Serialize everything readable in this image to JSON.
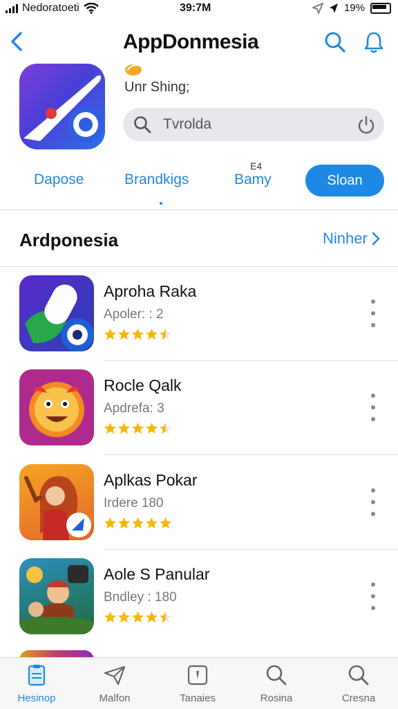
{
  "status_bar": {
    "carrier": "Nedoratoeti",
    "time": "39:7M",
    "battery": "19%"
  },
  "header": {
    "back_icon": "chevron-left-icon",
    "title": "AppDonmesia",
    "search_icon": "search-icon",
    "notify_icon": "bell-icon"
  },
  "hero": {
    "subtitle": "Unr Shing;",
    "search_value": "Tvrolda"
  },
  "tabs": {
    "items": [
      "Dapose",
      "Brandkigs",
      "Bamy",
      "Sloan"
    ],
    "bamy_superscript": "E4",
    "selected": "Sloan"
  },
  "section": {
    "title": "Ardponesia",
    "more_label": "Ninher"
  },
  "apps": [
    {
      "name": "Aproha Raka",
      "meta": "Apoler: : 2",
      "rating": 4.5
    },
    {
      "name": "Rocle Qalk",
      "meta": "Apdrefa: 3",
      "rating": 4.5
    },
    {
      "name": "Aplkas Pokar",
      "meta": "Irdere 180",
      "rating": 5
    },
    {
      "name": "Aole S Panular",
      "meta": "Bndley : 180",
      "rating": 4.5
    }
  ],
  "tabbar": {
    "items": [
      {
        "label": "Hesinop",
        "icon": "document-icon"
      },
      {
        "label": "Malfon",
        "icon": "paper-plane-icon"
      },
      {
        "label": "Tanaies",
        "icon": "card-icon"
      },
      {
        "label": "Rosina",
        "icon": "search-icon"
      },
      {
        "label": "Cresna",
        "icon": "search-icon"
      }
    ],
    "active_index": 0
  },
  "colors": {
    "accent": "#1e88e5",
    "star": "#f5b700"
  }
}
